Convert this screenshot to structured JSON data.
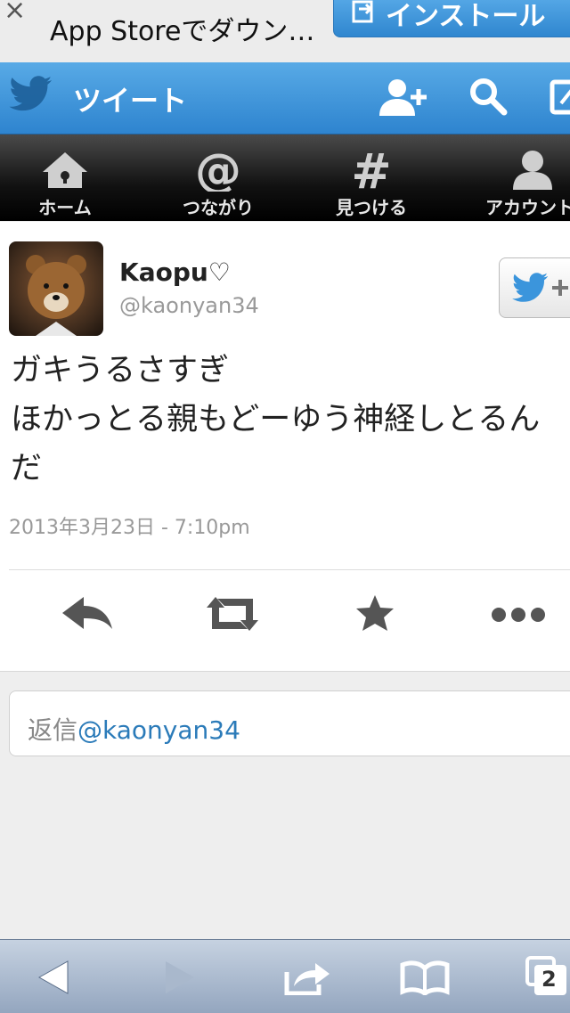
{
  "banner": {
    "close_glyph": "×",
    "title": "App Storeでダウン…",
    "install_label": "インストール"
  },
  "header": {
    "title": "ツイート",
    "icons": [
      "twitter-bird-icon",
      "add-user-icon",
      "search-icon",
      "compose-icon"
    ]
  },
  "nav": {
    "items": [
      {
        "label": "ホーム",
        "icon": "home-icon"
      },
      {
        "label": "つながり",
        "icon": "at-icon"
      },
      {
        "label": "見つける",
        "icon": "hash-icon"
      },
      {
        "label": "アカウント",
        "icon": "person-icon"
      }
    ]
  },
  "tweet": {
    "name": "Kaopu♡",
    "handle": "@kaonyan34",
    "lines": [
      "ガキうるさすぎ",
      "ほかっとる親もどーゆう神経しとるん",
      "だ"
    ],
    "timestamp": "2013年3月23日 - 7:10pm",
    "actions": [
      "reply-icon",
      "retweet-icon",
      "favorite-icon",
      "more-icon"
    ]
  },
  "reply": {
    "prefix": "返信",
    "mention": "@kaonyan34"
  },
  "toolbar": {
    "tabs_count": "2",
    "icons": [
      "back-icon",
      "forward-icon",
      "share-icon",
      "bookmarks-icon",
      "tabs-icon"
    ]
  },
  "colors": {
    "header_blue": "#3b95dc",
    "link_blue": "#2b7bb9",
    "nav_dark": "#111111"
  }
}
